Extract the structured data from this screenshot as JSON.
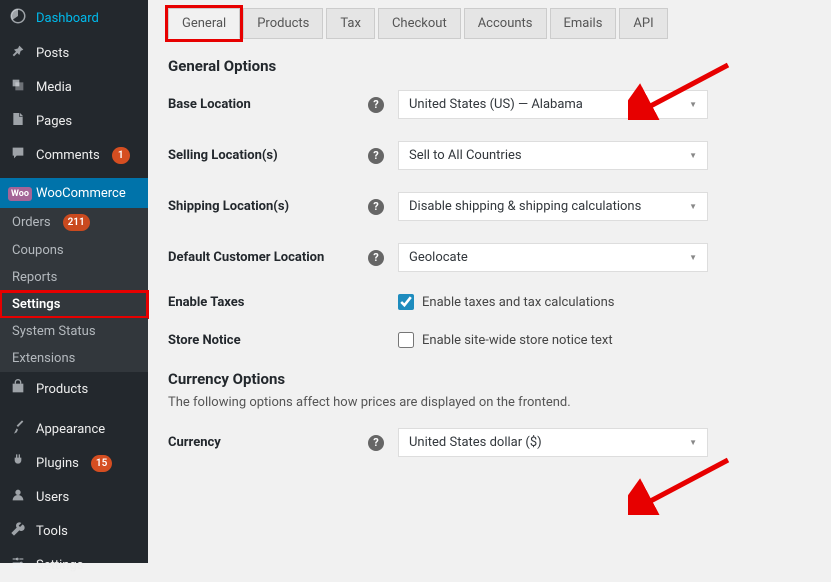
{
  "sidebar": {
    "dashboard": "Dashboard",
    "posts": "Posts",
    "media": "Media",
    "pages": "Pages",
    "comments": "Comments",
    "comments_badge": "1",
    "woocommerce": "WooCommerce",
    "sub": {
      "orders": "Orders",
      "orders_badge": "211",
      "coupons": "Coupons",
      "reports": "Reports",
      "settings": "Settings",
      "system_status": "System Status",
      "extensions": "Extensions"
    },
    "products": "Products",
    "appearance": "Appearance",
    "plugins": "Plugins",
    "plugins_badge": "15",
    "users": "Users",
    "tools": "Tools",
    "settings_bottom": "Settings"
  },
  "tabs": {
    "general": "General",
    "products": "Products",
    "tax": "Tax",
    "checkout": "Checkout",
    "accounts": "Accounts",
    "emails": "Emails",
    "api": "API"
  },
  "sections": {
    "general_options": "General Options",
    "base_location_lbl": "Base Location",
    "base_location_val": "United States (US) — Alabama",
    "selling_loc_lbl": "Selling Location(s)",
    "selling_loc_val": "Sell to All Countries",
    "shipping_loc_lbl": "Shipping Location(s)",
    "shipping_loc_val": "Disable shipping & shipping calculations",
    "default_cust_lbl": "Default Customer Location",
    "default_cust_val": "Geolocate",
    "enable_taxes_lbl": "Enable Taxes",
    "enable_taxes_cb": "Enable taxes and tax calculations",
    "store_notice_lbl": "Store Notice",
    "store_notice_cb": "Enable site-wide store notice text",
    "currency_options": "Currency Options",
    "currency_desc": "The following options affect how prices are displayed on the frontend.",
    "currency_lbl": "Currency",
    "currency_val": "United States dollar ($)"
  }
}
